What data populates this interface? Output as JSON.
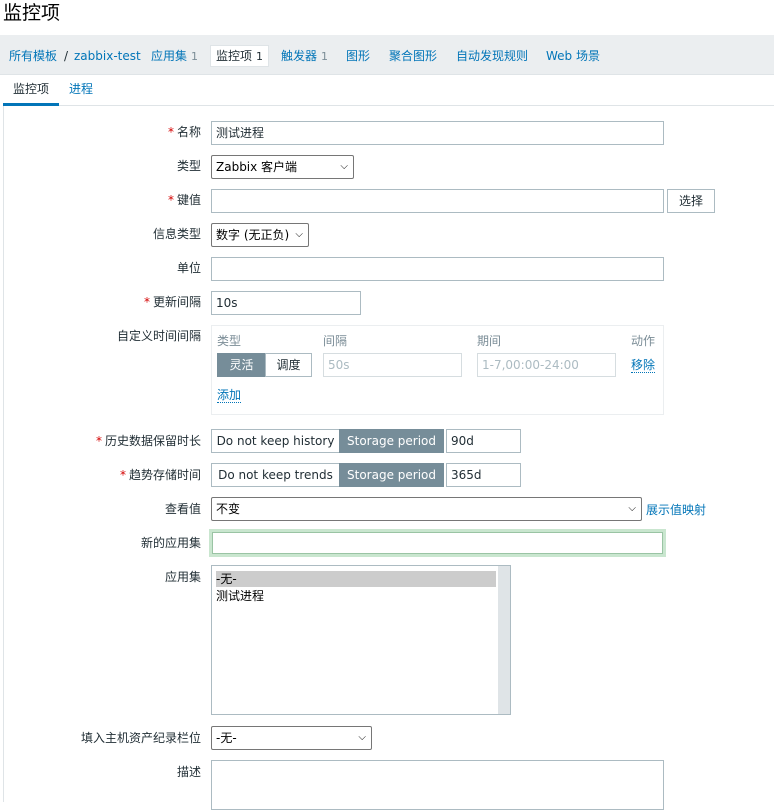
{
  "page": {
    "title": "监控项"
  },
  "breadcrumb": {
    "all_templates": "所有模板",
    "separator": "/",
    "host": "zabbix-test",
    "items": [
      {
        "label": "应用集",
        "count": "1"
      },
      {
        "label": "监控项",
        "count": "1",
        "active": true
      },
      {
        "label": "触发器",
        "count": "1"
      },
      {
        "label": "图形",
        "count": ""
      },
      {
        "label": "聚合图形",
        "count": ""
      },
      {
        "label": "自动发现规则",
        "count": ""
      },
      {
        "label": "Web 场景",
        "count": ""
      }
    ]
  },
  "tabs": [
    {
      "label": "监控项",
      "active": true
    },
    {
      "label": "进程",
      "active": false
    }
  ],
  "form": {
    "name": {
      "label": "名称",
      "required": true,
      "value": "测试进程"
    },
    "type": {
      "label": "类型",
      "value": "Zabbix 客户端"
    },
    "key": {
      "label": "键值",
      "required": true,
      "value": "",
      "select_button": "选择"
    },
    "info_type": {
      "label": "信息类型",
      "value": "数字 (无正负)"
    },
    "units": {
      "label": "单位",
      "value": ""
    },
    "update_interval": {
      "label": "更新间隔",
      "required": true,
      "value": "10s"
    },
    "custom_intervals": {
      "label": "自定义时间间隔",
      "col_type": "类型",
      "col_interval": "间隔",
      "col_period": "期间",
      "col_action": "动作",
      "flexible": "灵活",
      "scheduling": "调度",
      "interval_placeholder": "50s",
      "period_placeholder": "1-7,00:00-24:00",
      "remove": "移除",
      "add": "添加"
    },
    "history": {
      "label": "历史数据保留时长",
      "required": true,
      "opt_off": "Do not keep history",
      "opt_on": "Storage period",
      "value": "90d"
    },
    "trends": {
      "label": "趋势存储时间",
      "required": true,
      "opt_off": "Do not keep trends",
      "opt_on": "Storage period",
      "value": "365d"
    },
    "value_map": {
      "label": "查看值",
      "value": "不变",
      "show_link": "展示值映射"
    },
    "new_application": {
      "label": "新的应用集",
      "value": ""
    },
    "applications": {
      "label": "应用集",
      "options": [
        "-无-",
        "测试进程"
      ],
      "selected": "-无-"
    },
    "inventory": {
      "label": "填入主机资产纪录栏位",
      "value": "-无-"
    },
    "description": {
      "label": "描述",
      "value": ""
    }
  },
  "colors": {
    "link": "#0275b8",
    "required": "#d40000",
    "segment_active": "#768d99",
    "nav_background": "#ebeef0"
  }
}
